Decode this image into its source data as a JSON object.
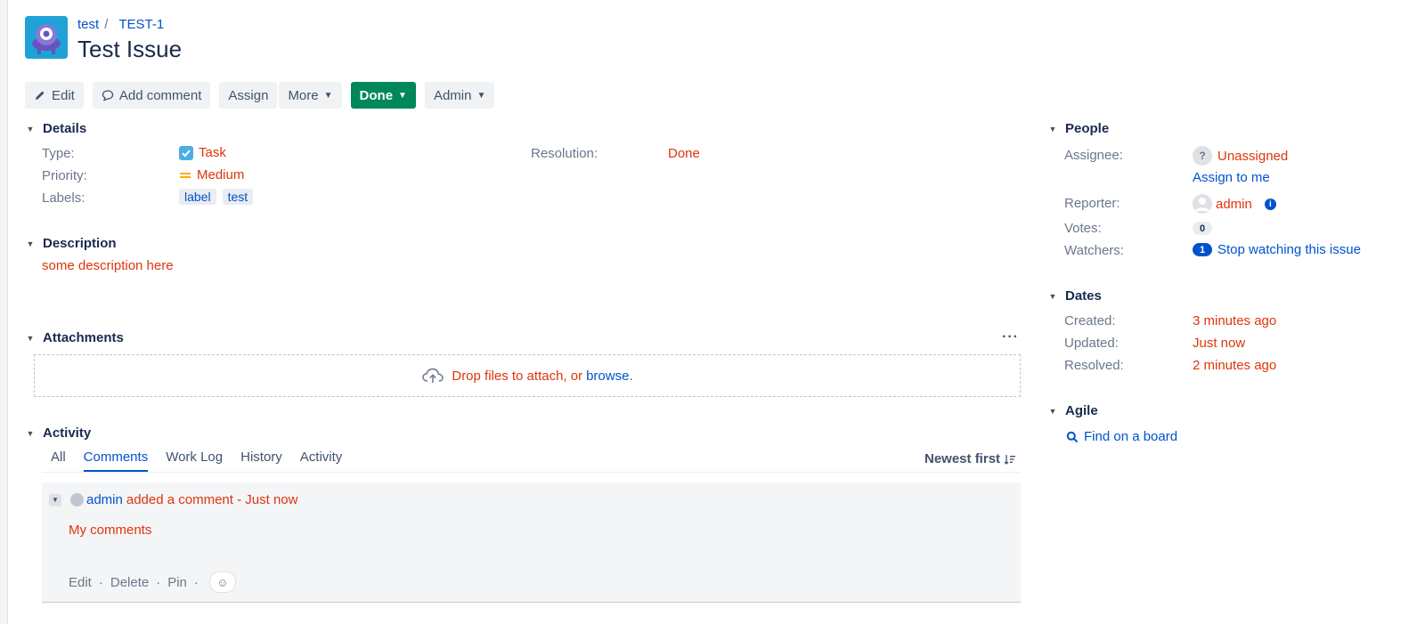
{
  "breadcrumb": {
    "project": "test",
    "issue_key": "TEST-1"
  },
  "issue": {
    "title": "Test Issue"
  },
  "toolbar": {
    "edit": "Edit",
    "add_comment": "Add comment",
    "assign": "Assign",
    "more": "More",
    "status": "Done",
    "admin": "Admin"
  },
  "details": {
    "heading": "Details",
    "type_label": "Type:",
    "type_value": "Task",
    "priority_label": "Priority:",
    "priority_value": "Medium",
    "labels_label": "Labels:",
    "labels": [
      "label",
      "test"
    ],
    "resolution_label": "Resolution:",
    "resolution_value": "Done"
  },
  "description": {
    "heading": "Description",
    "text": "some description here"
  },
  "attachments": {
    "heading": "Attachments",
    "drop_text": "Drop files to attach, or",
    "browse": "browse."
  },
  "activity": {
    "heading": "Activity",
    "tabs": [
      "All",
      "Comments",
      "Work Log",
      "History",
      "Activity"
    ],
    "active_tab": "Comments",
    "sort": "Newest first"
  },
  "comment": {
    "author": "admin",
    "meta": "added a comment - Just now",
    "body": "My comments",
    "actions": [
      "Edit",
      "Delete",
      "Pin"
    ]
  },
  "people": {
    "heading": "People",
    "assignee_label": "Assignee:",
    "assignee_value": "Unassigned",
    "assign_to_me": "Assign to me",
    "reporter_label": "Reporter:",
    "reporter_value": "admin",
    "votes_label": "Votes:",
    "votes_count": "0",
    "watchers_label": "Watchers:",
    "watchers_count": "1",
    "watch_link": "Stop watching this issue"
  },
  "dates": {
    "heading": "Dates",
    "created_label": "Created:",
    "created_value": "3 minutes ago",
    "updated_label": "Updated:",
    "updated_value": "Just now",
    "resolved_label": "Resolved:",
    "resolved_value": "2 minutes ago"
  },
  "agile": {
    "heading": "Agile",
    "find_board": "Find on a board"
  },
  "colors": {
    "link": "#0052cc",
    "status_done": "#00875a",
    "error_red": "#de350b",
    "priority_medium": "#ffab00"
  }
}
